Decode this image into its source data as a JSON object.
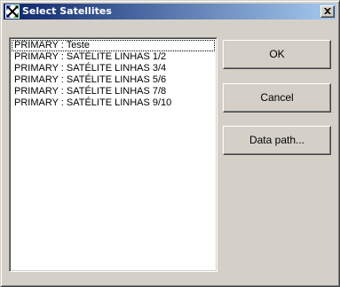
{
  "window": {
    "title": "Select Satellites",
    "close_glyph": "close-icon",
    "colors": {
      "titlebar_start": "#0a246a",
      "titlebar_end": "#a6caf0",
      "face": "#d4d0c8"
    }
  },
  "satellite_list": {
    "items": [
      "PRIMARY : Teste",
      "PRIMARY : SATÉLITE LINHAS 1/2",
      "PRIMARY : SATÉLITE LINHAS 3/4",
      "PRIMARY : SATÉLITE LINHAS 5/6",
      "PRIMARY : SATÉLITE LINHAS 7/8",
      "PRIMARY : SATÉLITE LINHAS 9/10"
    ]
  },
  "buttons": {
    "ok_label": "OK",
    "cancel_label": "Cancel",
    "data_path_label": "Data path..."
  }
}
